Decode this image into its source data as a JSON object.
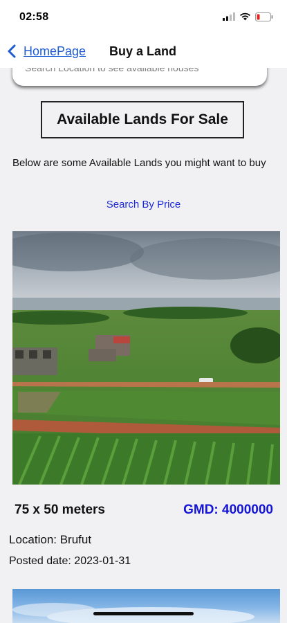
{
  "status_bar": {
    "time": "02:58"
  },
  "nav": {
    "back_label": "HomePage",
    "title": "Buy a Land"
  },
  "search": {
    "placeholder": "Search Location to see available houses"
  },
  "content": {
    "heading": "Available Lands For Sale",
    "intro": "Below are some Available Lands you might want to buy",
    "search_by_price": "Search By Price"
  },
  "listing": {
    "size": "75 x 50 meters",
    "price": "GMD: 4000000",
    "location": "Location: Brufut",
    "posted_date": "Posted date: 2023-01-31"
  },
  "colors": {
    "link_blue": "#1f5bd0",
    "price_blue": "#1414d8",
    "search_price_blue": "#1d2bd6"
  }
}
